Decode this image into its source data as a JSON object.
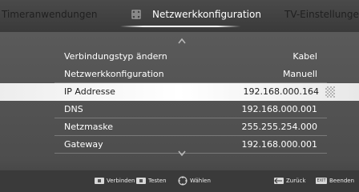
{
  "tabs": {
    "left": "Timeranwendungen",
    "center": "Netzwerkkonfiguration",
    "right": "TV-Einstellungen"
  },
  "rows": [
    {
      "label": "Verbindungstyp ändern",
      "value": "Kabel"
    },
    {
      "label": "Netzwerkkonfiguration",
      "value": "Manuell"
    },
    {
      "label": "IP Addresse",
      "value": "192.168.000.164",
      "selected": true
    },
    {
      "label": "DNS",
      "value": "192.168.000.001"
    },
    {
      "label": "Netzmaske",
      "value": "255.255.254.000"
    },
    {
      "label": "Gateway",
      "value": "192.168.000.001"
    }
  ],
  "hints": {
    "connect": "Verbinden",
    "test": "Testen",
    "select": "Wählen",
    "back": "Zurück",
    "exit_key": "EXIT",
    "exit": "Beenden"
  },
  "icons": {
    "tab": "network-settings-icon",
    "scroll_up": "chevron-up-icon",
    "scroll_down": "chevron-down-icon",
    "navigate": "dpad-icon",
    "back": "back-arrow-icon"
  },
  "colors": {
    "selected_row_bg": "#ffffff",
    "selected_row_text": "#1a1a1a",
    "tab_inactive_text": "#1f1f1f"
  }
}
